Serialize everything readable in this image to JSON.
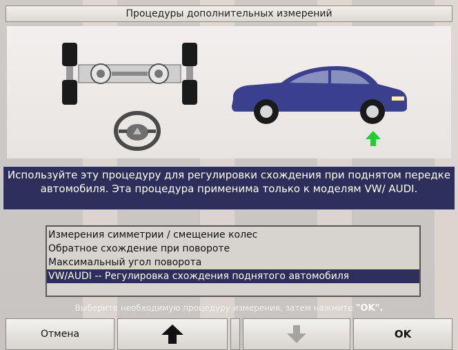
{
  "title": "Процедуры дополнительных измерений",
  "description": "Используйте эту процедуру для регулировки схождения при поднятом передке автомобиля. Эта процедура применима только к моделям VW/ AUDI.",
  "list": {
    "items": [
      "Измерения симметрии / смещение колес",
      "Обратное схождение при повороте",
      "Максимальный угол поворота",
      "VW/AUDI -- Регулировка схождения поднятого автомобиля"
    ],
    "selected_index": 3
  },
  "hint": {
    "text": "Выберите необходимую процедуру измерения, затем нажмите",
    "ok": "\"OK\"."
  },
  "buttons": {
    "cancel": "Отмена",
    "ok": "OK",
    "up_icon": "arrow-up-icon",
    "down_icon": "arrow-down-icon"
  },
  "colors": {
    "accent": "#2d2f5a",
    "car_body": "#3a3f8e",
    "arrow_green": "#22cc33"
  }
}
